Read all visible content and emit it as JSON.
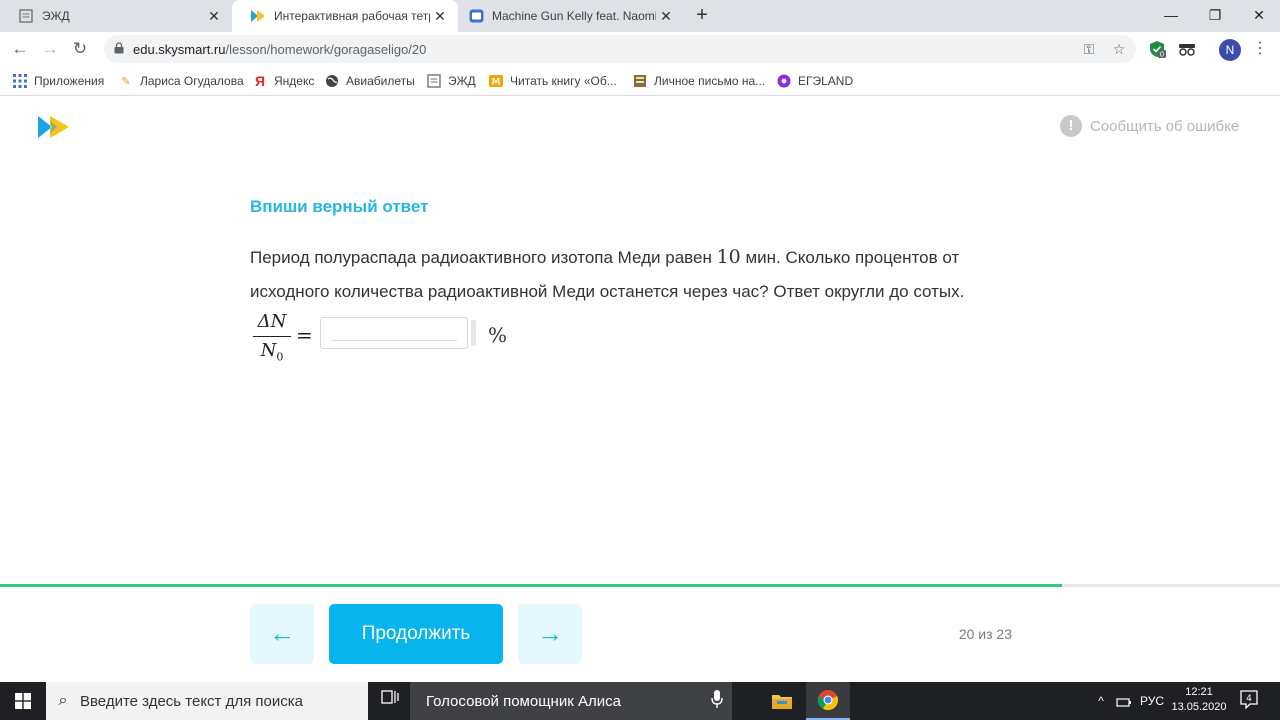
{
  "browser": {
    "tabs": [
      {
        "title": "ЭЖД",
        "favicon": "ezhd-icon",
        "active": false
      },
      {
        "title": "Интерактивная рабочая тетрадь",
        "favicon": "skysmart-icon",
        "active": true
      },
      {
        "title": "Machine Gun Kelly feat. Naomi Wild",
        "favicon": "video-icon",
        "active": false
      }
    ],
    "url_host": "edu.skysmart.ru",
    "url_path": "/lesson/homework/goragaseligo/20",
    "profile_initial": "N",
    "extension_badge": "0",
    "bookmarks": [
      {
        "label": "Приложения",
        "icon": "apps-grid-icon"
      },
      {
        "label": "Лариса Огудалова",
        "icon": "pencil-icon"
      },
      {
        "label": "Яндекс",
        "icon": "yandex-icon"
      },
      {
        "label": "Авиабилеты",
        "icon": "globe-icon"
      },
      {
        "label": "ЭЖД",
        "icon": "ezhd-icon"
      },
      {
        "label": "Читать книгу «Об...",
        "icon": "book-icon"
      },
      {
        "label": "Личное письмо на...",
        "icon": "doc-icon"
      },
      {
        "label": "ЕГЭLAND",
        "icon": "egeland-icon"
      }
    ]
  },
  "page": {
    "report_label": "Сообщить об ошибке",
    "task_title": "Впиши верный ответ",
    "task_text_before": "Период полураспада радиоактивного изотопа Меди равен ",
    "task_number": "10",
    "task_text_after": " мин. Сколько процентов от исходного количества радиоактивной Меди останется через час? Ответ округли до сотых.",
    "formula_numerator": "ΔN",
    "formula_denominator": "N",
    "formula_denominator_sub": "0",
    "formula_equals": "=",
    "answer_value": "",
    "unit": "%",
    "progress_fraction": 0.83,
    "prev_arrow": "←",
    "continue_label": "Продолжить",
    "next_arrow": "→",
    "counter": "20 из 23"
  },
  "taskbar": {
    "search_placeholder": "Введите здесь текст для поиска",
    "assistant_label": "Голосовой помощник Алиса",
    "language": "РУС",
    "time": "12:21",
    "date": "13.05.2020",
    "notifications": "4"
  },
  "colors": {
    "accent": "#07b4ee",
    "title": "#27b6e0",
    "progress": "#34c97d"
  }
}
